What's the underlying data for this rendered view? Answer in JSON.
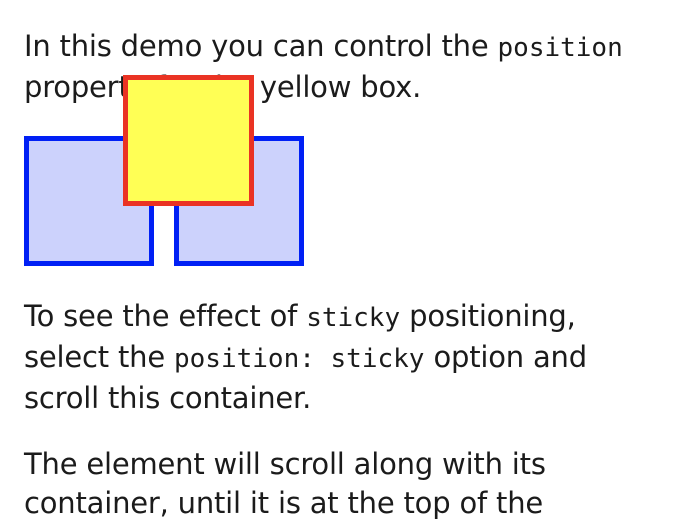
{
  "intro": {
    "part1": "In this demo you can control the ",
    "code": "position",
    "part2": "property for the yellow box."
  },
  "sticky_hint": {
    "part1": "To see the effect of ",
    "code1": "sticky",
    "part2": " positioning,",
    "part3": "select the ",
    "code2": "position: sticky",
    "part4": " option and",
    "part5": "scroll this container."
  },
  "scroll_note": {
    "line1": "The element will scroll along with its",
    "line2": "container, until it is at the top of the"
  },
  "colors": {
    "blue_box_fill": "#ccd2fc",
    "blue_box_border": "#0020f5",
    "yellow_box_fill": "#ffff55",
    "yellow_box_border": "#ea3323"
  }
}
